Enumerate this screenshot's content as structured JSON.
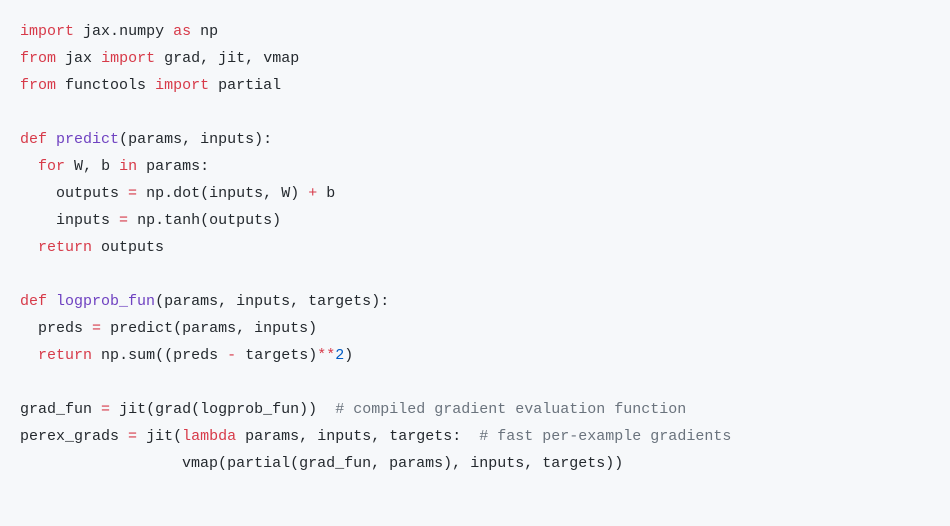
{
  "code": {
    "l01": {
      "import": "import",
      "mod1": "jax",
      "dot": ".",
      "mod2": "numpy",
      "as": "as",
      "alias": "np"
    },
    "l02": {
      "from": "from",
      "mod": "jax",
      "import": "import",
      "n1": "grad",
      "c1": ",",
      "n2": "jit",
      "c2": ",",
      "n3": "vmap"
    },
    "l03": {
      "from": "from",
      "mod": "functools",
      "import": "import",
      "n1": "partial"
    },
    "l05": {
      "def": "def",
      "name": "predict",
      "lp": "(",
      "p1": "params",
      "c1": ",",
      "p2": "inputs",
      "rp": ")",
      "colon": ":"
    },
    "l06": {
      "for": "for",
      "v1": "W",
      "c1": ",",
      "v2": "b",
      "in": "in",
      "it": "params",
      "colon": ":"
    },
    "l07": {
      "lhs": "outputs",
      "eq": "=",
      "np": "np",
      "dot1": ".",
      "dotfn": "dot",
      "lp": "(",
      "a1": "inputs",
      "c1": ",",
      "a2": "W",
      "rp": ")",
      "plus": "+",
      "b": "b"
    },
    "l08": {
      "lhs": "inputs",
      "eq": "=",
      "np": "np",
      "dot1": ".",
      "tanh": "tanh",
      "lp": "(",
      "arg": "outputs",
      "rp": ")"
    },
    "l09": {
      "return": "return",
      "val": "outputs"
    },
    "l11": {
      "def": "def",
      "name": "logprob_fun",
      "lp": "(",
      "p1": "params",
      "c1": ",",
      "p2": "inputs",
      "c2": ",",
      "p3": "targets",
      "rp": ")",
      "colon": ":"
    },
    "l12": {
      "lhs": "preds",
      "eq": "=",
      "fn": "predict",
      "lp": "(",
      "a1": "params",
      "c1": ",",
      "a2": "inputs",
      "rp": ")"
    },
    "l13": {
      "return": "return",
      "np": "np",
      "dot1": ".",
      "sum": "sum",
      "lp1": "(",
      "lp2": "(",
      "preds": "preds",
      "minus": "-",
      "targets": "targets",
      "rp2": ")",
      "pow": "**",
      "two": "2",
      "rp1": ")"
    },
    "l15": {
      "lhs": "grad_fun",
      "eq": "=",
      "jit": "jit",
      "lp1": "(",
      "grad": "grad",
      "lp2": "(",
      "arg": "logprob_fun",
      "rp2": ")",
      "rp1": ")",
      "comment": "# compiled gradient evaluation function"
    },
    "l16": {
      "lhs": "perex_grads",
      "eq": "=",
      "jit": "jit",
      "lp": "(",
      "lambda": "lambda",
      "p1": "params",
      "c1": ",",
      "p2": "inputs",
      "c2": ",",
      "p3": "targets",
      "colon": ":",
      "comment": "# fast per-example gradients"
    },
    "l17": {
      "vmap": "vmap",
      "lp1": "(",
      "partial": "partial",
      "lp2": "(",
      "a1": "grad_fun",
      "c1": ",",
      "a2": "params",
      "rp2": ")",
      "c2": ",",
      "a3": "inputs",
      "c3": ",",
      "a4": "targets",
      "rp1": ")",
      "rp0": ")"
    }
  }
}
